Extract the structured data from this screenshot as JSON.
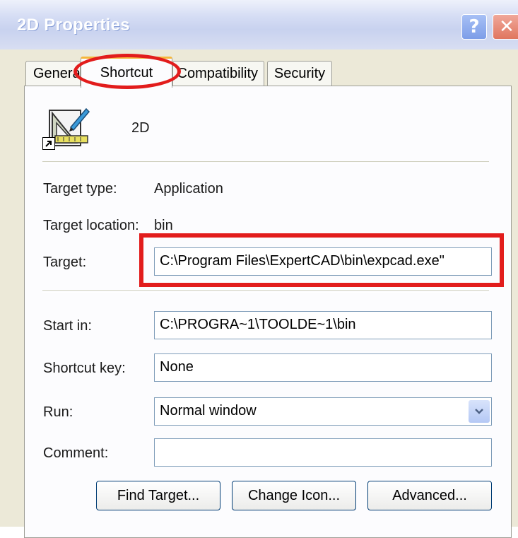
{
  "window": {
    "title": "2D Properties"
  },
  "titlebar": {
    "help_label": "?",
    "close_label": "✕"
  },
  "tabs": [
    {
      "label": "General",
      "active": false
    },
    {
      "label": "Shortcut",
      "active": true
    },
    {
      "label": "Compatibility",
      "active": false
    },
    {
      "label": "Security",
      "active": false
    }
  ],
  "shortcut": {
    "name": "2D",
    "target_type_label": "Target type:",
    "target_type_value": "Application",
    "target_location_label": "Target location:",
    "target_location_value": "bin",
    "target_label": "Target:",
    "target_value": "C:\\Program Files\\ExpertCAD\\bin\\expcad.exe\"",
    "start_in_label": "Start in:",
    "start_in_value": "C:\\PROGRA~1\\TOOLDE~1\\bin",
    "shortcut_key_label": "Shortcut key:",
    "shortcut_key_value": "None",
    "run_label": "Run:",
    "run_value": "Normal window",
    "comment_label": "Comment:",
    "comment_value": ""
  },
  "buttons": {
    "find_target": "Find Target...",
    "change_icon": "Change Icon...",
    "advanced": "Advanced..."
  },
  "icons": {
    "app_icon": "drafting-triangle-pencil-icon",
    "shortcut_overlay": "shortcut-arrow-icon",
    "dropdown": "chevron-down-icon"
  },
  "colors": {
    "annotation": "#e21c1c",
    "active_tab_accent": "#f5b63a"
  }
}
